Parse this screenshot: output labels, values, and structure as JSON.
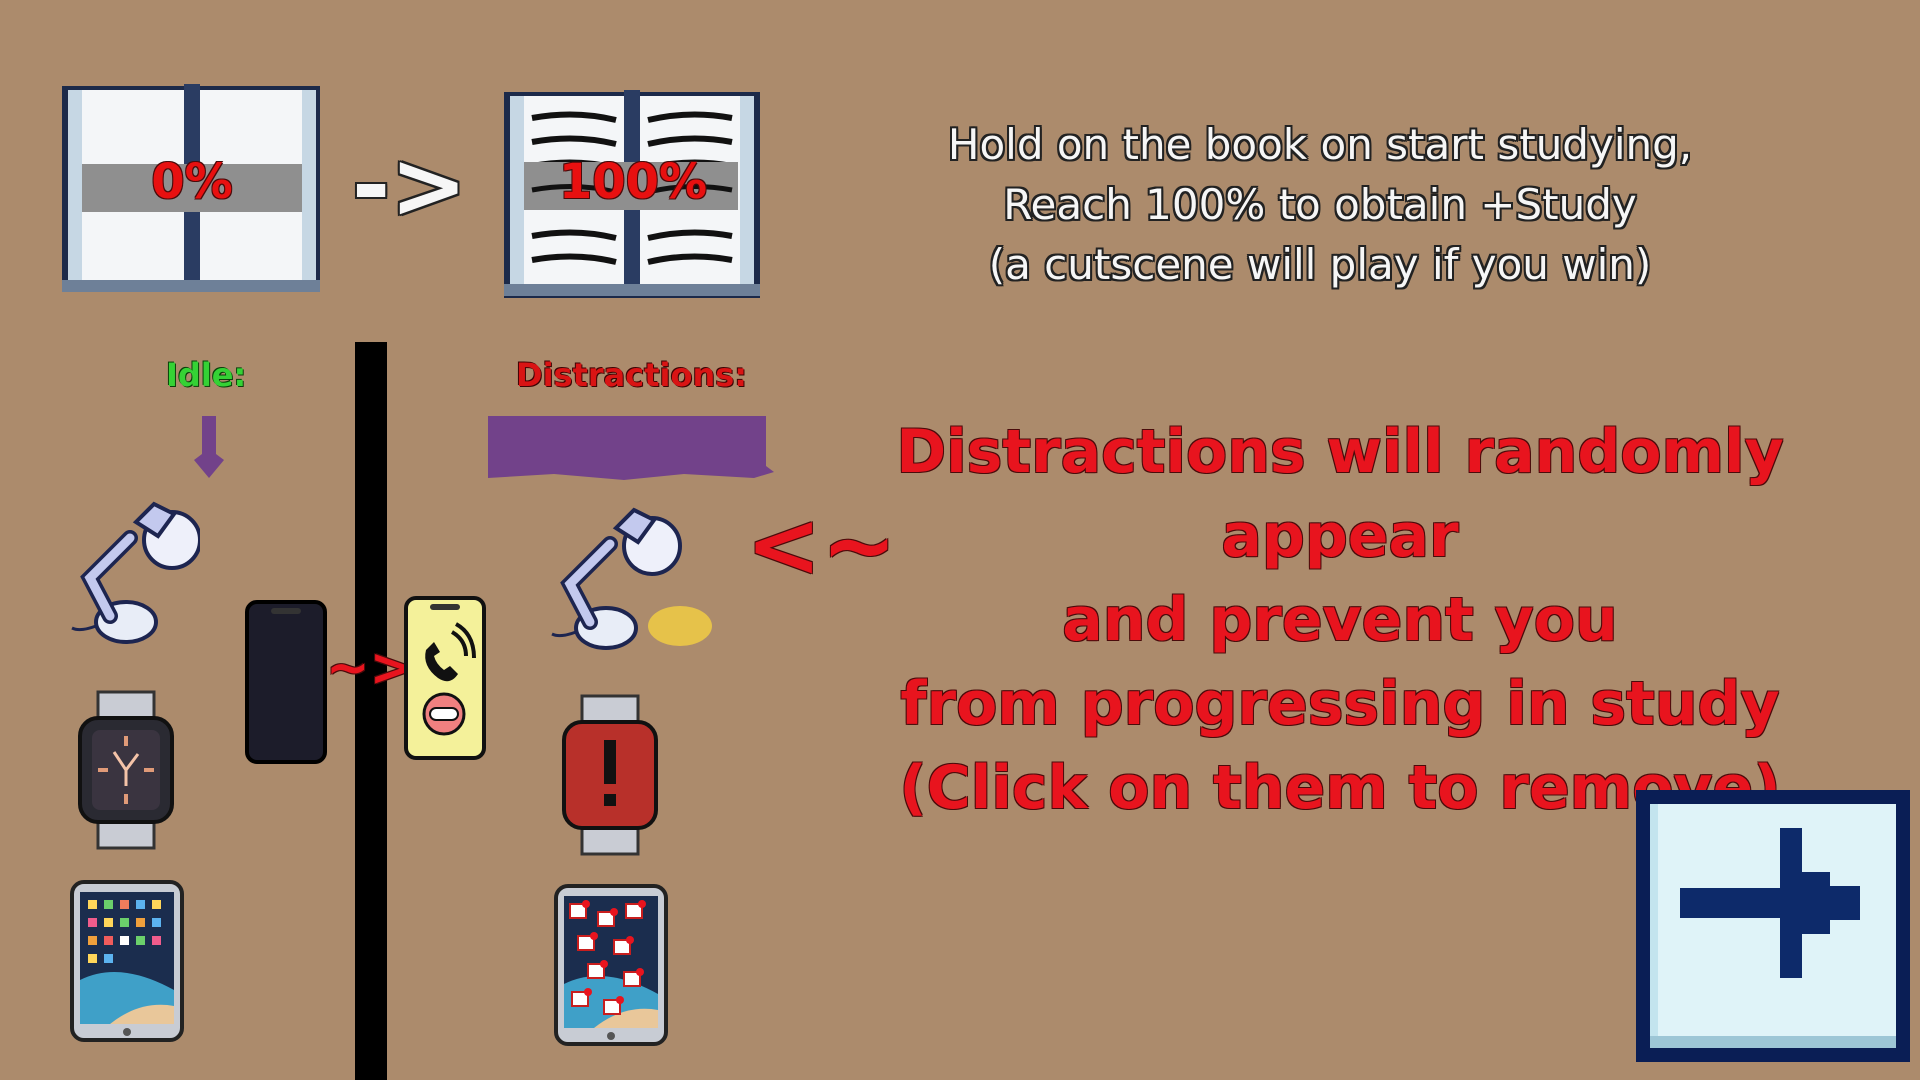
{
  "book": {
    "start_progress": "0%",
    "end_progress": "100%",
    "arrow": "->"
  },
  "instructions": {
    "line1": "Hold on the book on start studying,",
    "line2": "Reach 100% to obtain +Study",
    "line3": "(a cutscene will play if you win)"
  },
  "idle": {
    "label": "Idle:",
    "items": [
      "lamp-icon",
      "smartwatch-icon",
      "tablet-icon",
      "phone-icon"
    ]
  },
  "distractions": {
    "label": "Distractions:",
    "items": [
      "lamp-on-icon",
      "smartwatch-alert-icon",
      "tablet-notifications-icon",
      "phone-ringing-icon"
    ],
    "arrow_phone": "~>",
    "pointer": "<~",
    "line1": "Distractions will randomly appear",
    "line2": "and prevent you",
    "line3": "from progressing in study",
    "line4": "(Click on them to remove)"
  },
  "colors": {
    "background": "#ac8b6c",
    "idle_label": "#35d235",
    "distraction_text": "#e8141e",
    "banner": "#72428a",
    "next_button": "#0a1e55"
  },
  "controls": {
    "next_icon": "arrow-right-icon"
  }
}
